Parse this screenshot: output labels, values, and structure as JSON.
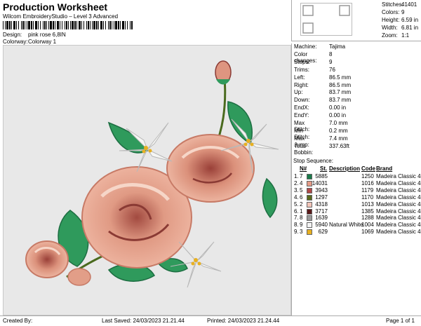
{
  "header": {
    "title": "Production Worksheet",
    "subtitle": "Wilcom EmbroideryStudio – Level 3 Advanced",
    "design_label": "Design:",
    "design_value": "pink rose 6,8IN",
    "colorway_label": "Colorway:",
    "colorway_value": "Colorway 1"
  },
  "stats": [
    {
      "label": "Stitches:",
      "value": "41401"
    },
    {
      "label": "Colors:",
      "value": "9"
    },
    {
      "label": "Height:",
      "value": "6.59 in"
    },
    {
      "label": "Width:",
      "value": "6.81 in"
    },
    {
      "label": "Zoom:",
      "value": "1:1"
    }
  ],
  "machine_info": [
    {
      "label": "Machine:",
      "value": "Tajima"
    },
    {
      "label": "Color changes:",
      "value": "8"
    },
    {
      "label": "Stops:",
      "value": "9"
    },
    {
      "label": "Trims:",
      "value": "76"
    },
    {
      "label": "Left:",
      "value": "86.5 mm"
    },
    {
      "label": "Right:",
      "value": "86.5 mm"
    },
    {
      "label": "Up:",
      "value": "83.7 mm"
    },
    {
      "label": "Down:",
      "value": "83.7 mm"
    },
    {
      "label": "EndX:",
      "value": "0.00 in"
    },
    {
      "label": "EndY:",
      "value": "0.00 in"
    },
    {
      "label": "Max Stitch:",
      "value": "7.0 mm"
    },
    {
      "label": "Min Stitch:",
      "value": "0.2 mm"
    },
    {
      "label": "Max Jump:",
      "value": "7.4 mm"
    },
    {
      "label": "Total Bobbin:",
      "value": "337.63ft"
    }
  ],
  "stop_sequence": {
    "title": "Stop Sequence:",
    "headers": {
      "stop": "",
      "n": "N#",
      "st": "St.",
      "description": "Description",
      "code": "Code",
      "brand": "Brand"
    },
    "rows": [
      {
        "stop": "1.",
        "n": "7",
        "color": "#1a7a4a",
        "st": "5885",
        "description": "",
        "code": "1250",
        "brand": "Madeira Classic 40"
      },
      {
        "stop": "2.",
        "n": "4",
        "color": "#e59a86",
        "st": "14031",
        "description": "",
        "code": "1016",
        "brand": "Madeira Classic 40"
      },
      {
        "stop": "3.",
        "n": "5",
        "color": "#b04848",
        "st": "3943",
        "description": "",
        "code": "1179",
        "brand": "Madeira Classic 40"
      },
      {
        "stop": "4.",
        "n": "6",
        "color": "#5a6a1e",
        "st": "1297",
        "description": "",
        "code": "1170",
        "brand": "Madeira Classic 40"
      },
      {
        "stop": "5.",
        "n": "2",
        "color": "#f2c4b8",
        "st": "4318",
        "description": "",
        "code": "1013",
        "brand": "Madeira Classic 40"
      },
      {
        "stop": "6.",
        "n": "1",
        "color": "#5a1a1a",
        "st": "3717",
        "description": "",
        "code": "1385",
        "brand": "Madeira Classic 40"
      },
      {
        "stop": "7.",
        "n": "8",
        "color": "#9a9a9a",
        "st": "1639",
        "description": "",
        "code": "1288",
        "brand": "Madeira Classic 40"
      },
      {
        "stop": "8.",
        "n": "9",
        "color": "#f4f4f4",
        "st": "5940",
        "description": "Natural White",
        "code": "1004",
        "brand": "Madeira Classic 40"
      },
      {
        "stop": "9.",
        "n": "3",
        "color": "#e8b020",
        "st": "629",
        "description": "",
        "code": "1069",
        "brand": "Madeira Classic 40"
      }
    ]
  },
  "footer": {
    "created_by": "Created By:",
    "last_saved": "Last Saved: 24/03/2023 21.21.44",
    "printed": "Printed: 24/03/2023 21.24.44",
    "page": "Page 1 of 1"
  },
  "colors": {
    "rose_light": "#e9a48f",
    "rose_mid": "#d98872",
    "rose_dark": "#8a3a34",
    "leaf": "#2f9a5c",
    "leaf_dark": "#1d6e42",
    "petal_white": "#f6f6f4",
    "stamen": "#e8b020"
  },
  "icons": {
    "barcode": "barcode-icon",
    "qr": "qr-code-icon"
  }
}
